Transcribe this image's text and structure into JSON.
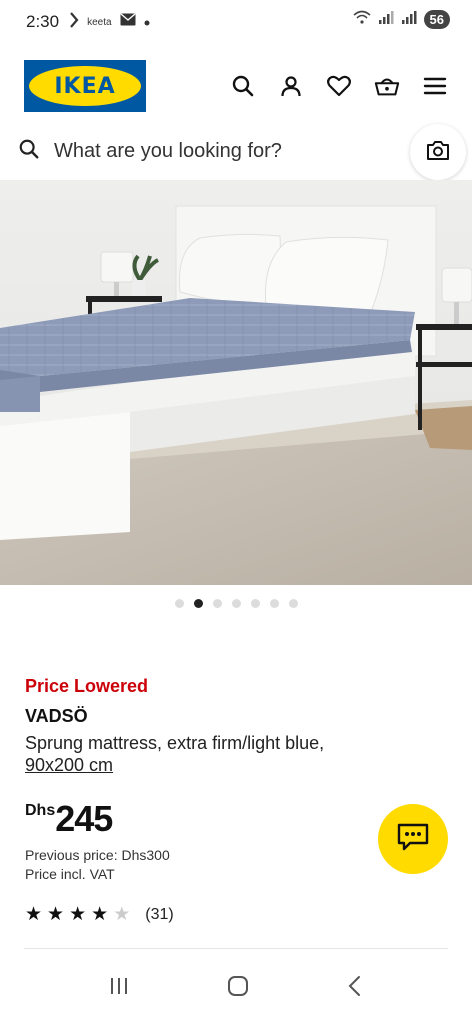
{
  "status_bar": {
    "time": "2:30",
    "notification_text": "keeta",
    "battery": "56"
  },
  "header": {
    "logo_text": "IKEA",
    "icons": [
      "search-icon",
      "account-icon",
      "heart-icon",
      "basket-icon",
      "menu-icon"
    ]
  },
  "search": {
    "placeholder": "What are you looking for?"
  },
  "carousel": {
    "total": 7,
    "active_index": 1
  },
  "product": {
    "badge": "Price Lowered",
    "name": "VADSÖ",
    "description": "Sprung mattress, extra firm/light blue,",
    "size": "90x200 cm",
    "currency": "Dhs",
    "price": "245",
    "previous_price": "Previous price: Dhs300",
    "vat_note": "Price incl. VAT",
    "rating_stars": 4,
    "rating_max": 5,
    "review_count": "(31)"
  },
  "colors": {
    "ikea_blue": "#0058a3",
    "ikea_yellow": "#ffdb00",
    "price_red": "#cc0008"
  }
}
